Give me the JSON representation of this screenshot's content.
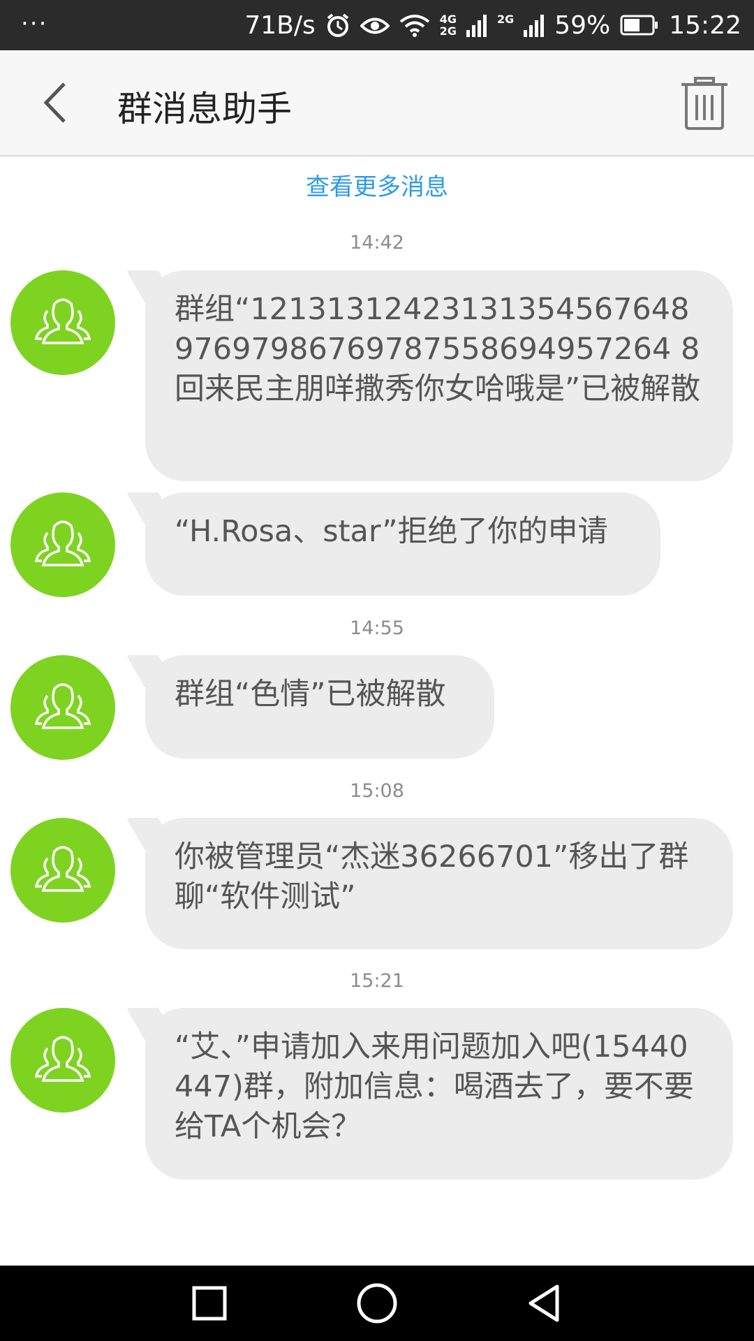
{
  "status_bar": {
    "dots": "···",
    "net_speed": "71B/s",
    "net_type_top": "4G",
    "net_type_bottom": "2G",
    "net_type2": "2G",
    "battery": "59%",
    "time": "15:22"
  },
  "header": {
    "title": "群消息助手"
  },
  "more_link": "查看更多消息",
  "colors": {
    "accent_link": "#2d9be8",
    "avatar_green": "#7ed321",
    "bubble_bg": "#ececec"
  },
  "messages": [
    {
      "timestamp": "14:42",
      "text": "群组“1213131242313135456764897697986769787558694957264 8回来民主朋咩撒秀你女哈哦是”已被解散"
    },
    {
      "timestamp": "",
      "text": "“H.Rosa、star”拒绝了你的申请"
    },
    {
      "timestamp": "14:55",
      "text": "群组“色情”已被解散"
    },
    {
      "timestamp": "15:08",
      "text": "你被管理员“杰迷36266701”移出了群聊“软件测试”"
    },
    {
      "timestamp": "15:21",
      "text": "“艾、”申请加入来用问题加入吧(15440447)群，附加信息：喝酒去了，要不要给TA个机会？"
    }
  ],
  "nav": {
    "icons": [
      "square-icon",
      "circle-icon",
      "triangle-back-icon"
    ]
  }
}
